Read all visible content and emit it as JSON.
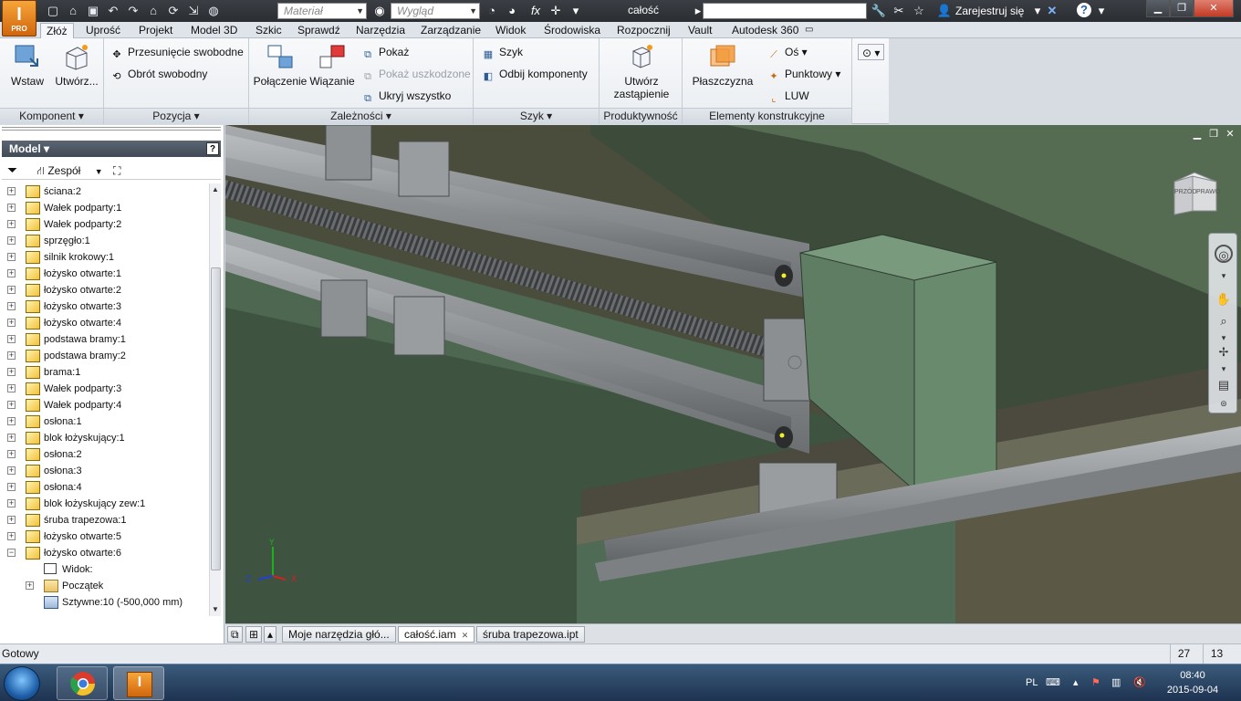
{
  "app": {
    "logo_letter": "I",
    "logo_sub": "PRO",
    "window_title": "całość",
    "material_placeholder": "Materiał",
    "appearance_placeholder": "Wygląd",
    "signin_label": "Zarejestruj się",
    "help_label": "?",
    "fx_label": "fx"
  },
  "tabs": [
    "Złóż",
    "Uprość",
    "Projekt",
    "Model 3D",
    "Szkic",
    "Sprawdź",
    "Narzędzia",
    "Zarządzanie",
    "Widok",
    "Środowiska",
    "Rozpocznij",
    "Vault",
    "Autodesk 360"
  ],
  "ribbon": {
    "komponent": {
      "label": "Komponent",
      "place": "Wstaw",
      "create": "Utwórz..."
    },
    "pozycja": {
      "label": "Pozycja",
      "free_move": "Przesunięcie swobodne",
      "free_rotate": "Obrót swobodny"
    },
    "zaleznosci": {
      "label": "Zależności",
      "connect": "Połączenie",
      "constrain": "Wiązanie",
      "show": "Pokaż",
      "show_broken": "Pokaż uszkodzone",
      "hide_all": "Ukryj wszystko"
    },
    "szyk": {
      "label": "Szyk",
      "pattern": "Szyk",
      "mirror": "Odbij komponenty"
    },
    "produktywnosc": {
      "label": "Produktywność",
      "substitute_1": "Utwórz",
      "substitute_2": "zastąpienie"
    },
    "elementy": {
      "label": "Elementy konstrukcyjne",
      "plane": "Płaszczyzna",
      "axis": "Oś",
      "point": "Punktowy",
      "ucs": "LUW"
    }
  },
  "browser": {
    "title": "Model",
    "help": "?",
    "filter_label": "Zespół",
    "items": [
      "ściana:2",
      "Wałek podparty:1",
      "Wałek podparty:2",
      "sprzęgło:1",
      "silnik krokowy:1",
      "łożysko otwarte:1",
      "łożysko otwarte:2",
      "łożysko otwarte:3",
      "łożysko otwarte:4",
      "podstawa bramy:1",
      "podstawa bramy:2",
      "brama:1",
      "Wałek podparty:3",
      "Wałek podparty:4",
      "osłona:1",
      "blok łożyskujący:1",
      "osłona:2",
      "osłona:3",
      "osłona:4",
      "blok łożyskujący zew:1",
      "śruba trapezowa:1",
      "łożysko otwarte:5",
      "łożysko otwarte:6"
    ],
    "sub_items": [
      "Widok:",
      "Początek",
      "Sztywne:10 (-500,000 mm)"
    ]
  },
  "viewcube": {
    "front": "PRZÓD",
    "right": "PRAWO"
  },
  "doc_tabs": [
    "Moje narzędzia głó...",
    "całość.iam",
    "śruba trapezowa.ipt"
  ],
  "status": {
    "text": "Gotowy",
    "num1": "27",
    "num2": "13"
  },
  "taskbar": {
    "lang": "PL",
    "time": "08:40",
    "date": "2015-09-04"
  },
  "colors": {
    "accent_orange": "#e8821e",
    "viewport_green": "#5a7a5e",
    "ribbon_bg": "#eef1f4"
  }
}
